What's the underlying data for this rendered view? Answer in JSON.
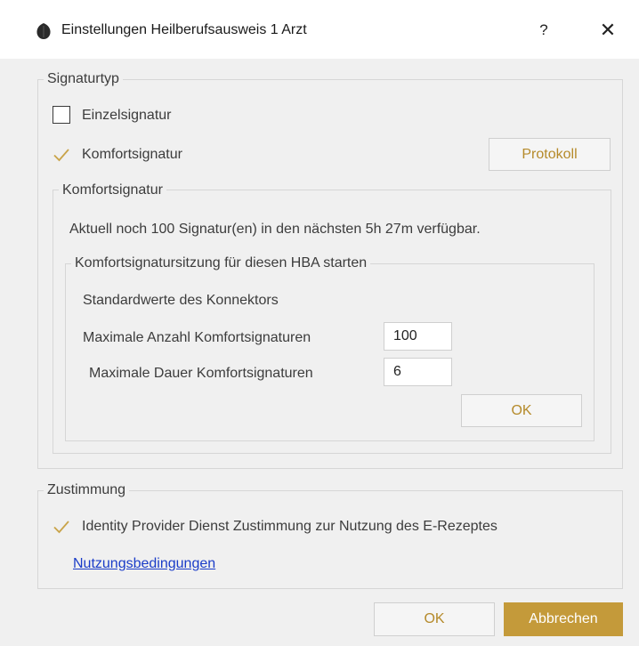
{
  "window": {
    "title": "Einstellungen Heilberufsausweis 1 Arzt",
    "help": "?",
    "close": "✕"
  },
  "signaturtyp": {
    "group_title": "Signaturtyp",
    "einzelsignatur": {
      "label": "Einzelsignatur",
      "checked": false
    },
    "komfortsignatur": {
      "label": "Komfortsignatur",
      "checked": true
    },
    "protokoll_button": "Protokoll"
  },
  "komfort": {
    "group_title": "Komfortsignatur",
    "status_text": "Aktuell noch 100 Signatur(en) in den nächsten 5h 27m verfügbar.",
    "session": {
      "group_title": "Komfortsignatursitzung für diesen HBA starten",
      "defaults_label": "Standardwerte des Konnektors",
      "max_count_label": "Maximale Anzahl Komfortsignaturen",
      "max_count_value": "100",
      "max_duration_label": "Maximale Dauer Komfortsignaturen",
      "max_duration_value": "6",
      "ok_button": "OK"
    }
  },
  "zustimmung": {
    "group_title": "Zustimmung",
    "consent": {
      "label": "Identity Provider Dienst Zustimmung zur Nutzung des E-Rezeptes",
      "checked": true
    },
    "terms_link": "Nutzungsbedingungen"
  },
  "footer": {
    "ok_button": "OK",
    "cancel_button": "Abbrechen"
  },
  "colors": {
    "accent": "#c49a3a",
    "check": "#c9a44a",
    "link": "#1a3cc8"
  }
}
